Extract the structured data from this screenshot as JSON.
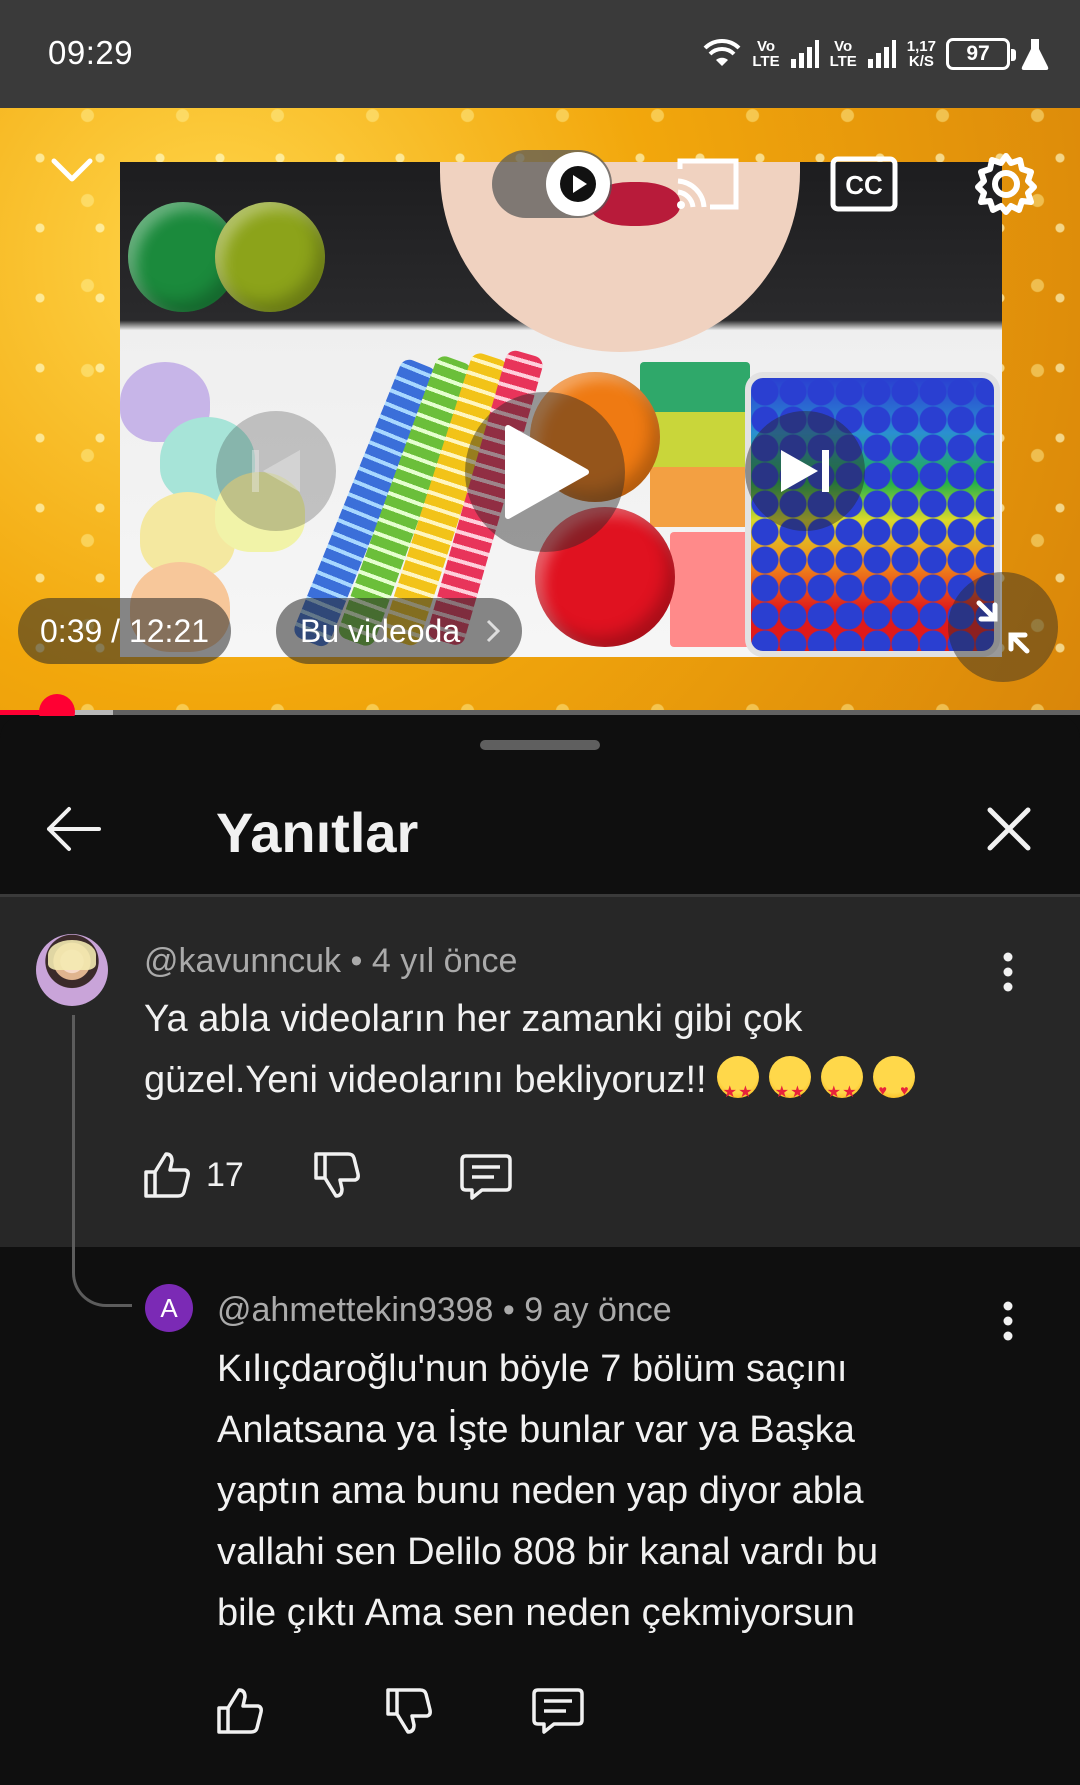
{
  "status_bar": {
    "time": "09:29",
    "net_speed_value": "1,17",
    "net_speed_unit": "K/S",
    "battery": "97",
    "vo_label": "Vo",
    "lte_label": "LTE"
  },
  "player": {
    "time_display": "0:39 / 12:21",
    "chapter_label": "Bu videoda",
    "progress_fraction": 0.053,
    "buffer_fraction": 0.105,
    "icons": [
      "chevron-down-icon",
      "autoplay-toggle-icon",
      "cast-icon",
      "captions-icon",
      "settings-icon",
      "previous-icon",
      "play-icon",
      "next-icon",
      "fullscreen-exit-icon"
    ]
  },
  "sheet": {
    "title": "Yanıtlar",
    "back_icon": "arrow-left-icon",
    "close_icon": "close-icon"
  },
  "parent_comment": {
    "author": "@kavunncuk",
    "separator": " • ",
    "age": "4 yıl önce",
    "text_line1": "Ya abla videoların her zamanki gibi çok",
    "text_line2": "güzel.Yeni videolarını bekliyoruz!!",
    "likes": "17"
  },
  "reply": {
    "avatar_letter": "A",
    "author": "@ahmettekin9398",
    "separator": " • ",
    "age": "9 ay önce",
    "lines": [
      "Kılıçdaroğlu'nun böyle 7 bölüm saçını",
      "Anlatsana ya İşte bunlar var ya Başka",
      "yaptın ama bunu neden yap diyor abla",
      "vallahi sen Delilo 808 bir kanal vardı bu",
      "bile çıktı Ama sen neden çekmiyorsun"
    ]
  },
  "colors": {
    "accent_red": "#ff0033",
    "sheet_bg": "#0f0f0f",
    "highlight_bg": "#272727",
    "muted_text": "#aaaaaa",
    "reply_avatar": "#7b2ab5"
  }
}
